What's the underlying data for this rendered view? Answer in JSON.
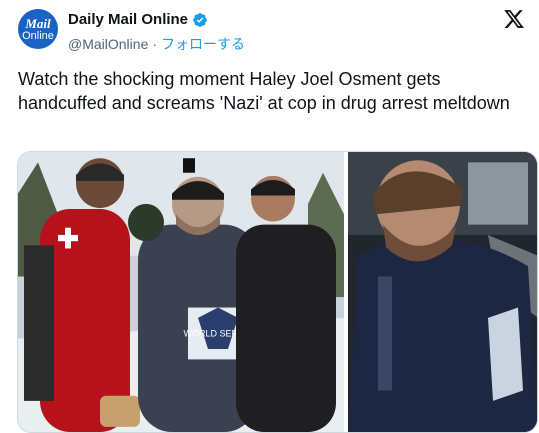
{
  "account": {
    "avatar_line1": "Mail",
    "avatar_line2": "Online",
    "display_name": "Daily Mail Online",
    "handle": "@MailOnline",
    "separator": "·",
    "follow_label": "フォローする"
  },
  "tweet": {
    "text": "Watch the shocking moment Haley Joel Osment gets handcuffed and screams 'Nazi' at cop in drug arrest meltdown"
  },
  "media": {
    "photo1_caption_text": "WORLD SERIES",
    "photo2_caption_text": ""
  },
  "icons": {
    "avatar": "daily-mail-avatar",
    "verified": "verified-badge-icon",
    "brand": "x-logo-icon"
  },
  "colors": {
    "accent": "#1d9bf0",
    "avatar_bg": "#1a63c6",
    "secondary_text": "#536471"
  }
}
